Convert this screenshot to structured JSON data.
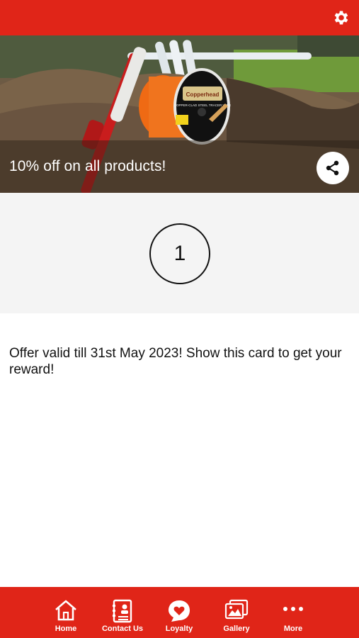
{
  "header": {
    "settings_icon": "gear-icon"
  },
  "offer": {
    "title": "10% off on all products!",
    "stamp_count": "1",
    "description": "Offer valid till 31st May 2023! Show this card to get your reward!",
    "share_icon": "share-icon",
    "product_label_brand": "Copperhead",
    "product_label_text": "COPPER-CLAD STEEL TRACER WIRE"
  },
  "bottom_nav": {
    "items": [
      {
        "label": "Home",
        "icon": "home-icon"
      },
      {
        "label": "Contact Us",
        "icon": "contact-card-icon"
      },
      {
        "label": "Loyalty",
        "icon": "heart-badge-icon"
      },
      {
        "label": "Gallery",
        "icon": "gallery-icon"
      },
      {
        "label": "More",
        "icon": "more-dots-icon"
      }
    ]
  },
  "colors": {
    "brand_red": "#e02518",
    "stamp_bg": "#f4f4f4"
  }
}
